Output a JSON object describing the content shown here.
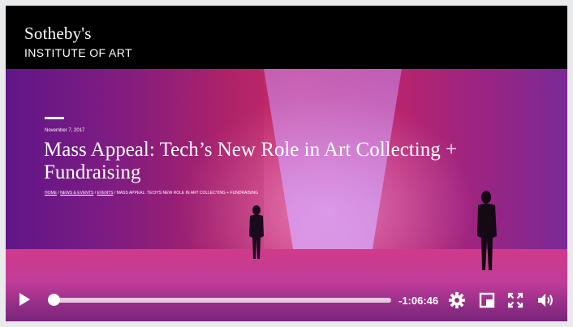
{
  "brand": {
    "name": "Sotheby's",
    "subtitle": "INSTITUTE OF ART"
  },
  "article": {
    "date": "November 7, 2017",
    "title": "Mass Appeal: Tech’s New Role in Art Collecting + Fundraising",
    "breadcrumbs": [
      "HOME",
      "NEWS & EVENTS",
      "EVENTS",
      "MASS APPEAL: TECH’S NEW ROLE IN ART COLLECTING + FUNDRAISING"
    ],
    "breadcrumb_separator": "/"
  },
  "player": {
    "time_remaining": "-1:06:46",
    "progress": 0.01,
    "icons": [
      "play-icon",
      "gear-icon",
      "picture-in-picture-icon",
      "fullscreen-icon",
      "volume-icon"
    ]
  }
}
